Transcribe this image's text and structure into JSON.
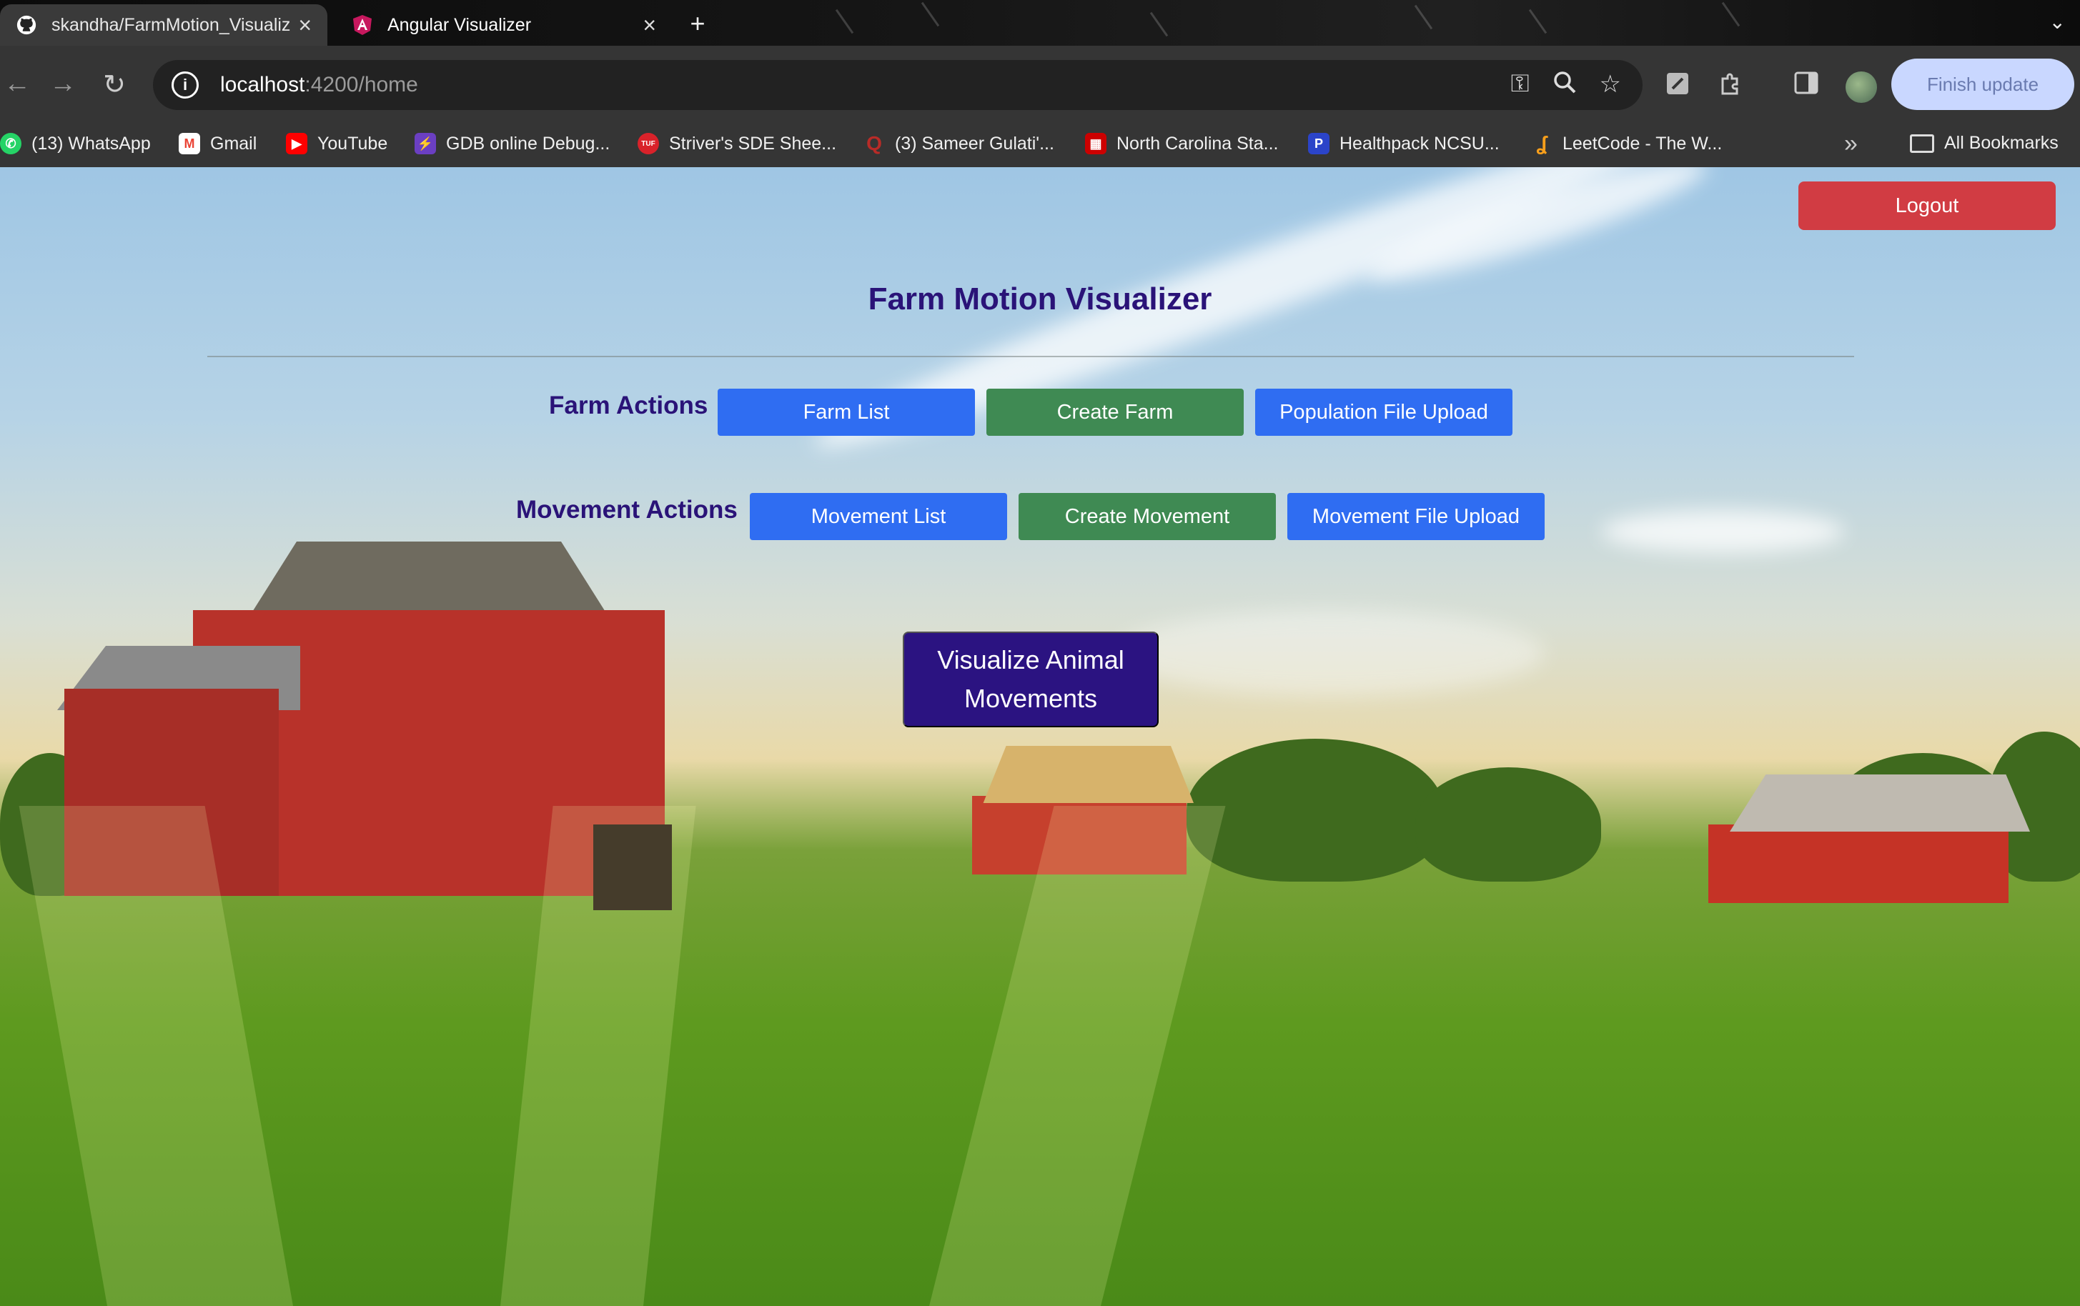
{
  "browser": {
    "tabs": [
      {
        "title": "skandha/FarmMotion_Visualiz",
        "active": false,
        "icon": "github-icon"
      },
      {
        "title": "Angular Visualizer",
        "active": true,
        "icon": "angular-icon"
      }
    ],
    "new_tab": "+",
    "url": {
      "host": "localhost",
      "path": ":4200/home"
    },
    "finish_update_label": "Finish update",
    "bookmarks": [
      {
        "label": "(13) WhatsApp",
        "icon": "whatsapp-icon",
        "color": "#25d366"
      },
      {
        "label": "Gmail",
        "icon": "gmail-icon",
        "color": "#ea4335"
      },
      {
        "label": "YouTube",
        "icon": "youtube-icon",
        "color": "#ff0000"
      },
      {
        "label": "GDB online Debug...",
        "icon": "gdb-icon",
        "color": "#6b3fc2"
      },
      {
        "label": "Striver's SDE Shee...",
        "icon": "tuf-icon",
        "color": "#d9222a"
      },
      {
        "label": "(3) Sameer Gulati'...",
        "icon": "quora-icon",
        "color": "#b92b27"
      },
      {
        "label": "North Carolina Sta...",
        "icon": "ncsu-icon",
        "color": "#cc0000"
      },
      {
        "label": "Healthpack NCSU...",
        "icon": "healthpack-icon",
        "color": "#2b44c9"
      },
      {
        "label": "LeetCode - The W...",
        "icon": "leetcode-icon",
        "color": "#f89f1b"
      }
    ],
    "all_bookmarks_label": "All Bookmarks"
  },
  "page": {
    "logout_label": "Logout",
    "title": "Farm Motion Visualizer",
    "farm_actions": {
      "label": "Farm Actions",
      "buttons": [
        "Farm List",
        "Create Farm",
        "Population File Upload"
      ]
    },
    "movement_actions": {
      "label": "Movement Actions",
      "buttons": [
        "Movement List",
        "Create Movement",
        "Movement File Upload"
      ]
    },
    "visualize_label": "Visualize Animal Movements"
  },
  "colors": {
    "primary_blue": "#2f6df2",
    "green": "#3f8a53",
    "logout_red": "#d13c43",
    "title_purple": "#2a1378",
    "visualize_purple": "#2b1381"
  }
}
